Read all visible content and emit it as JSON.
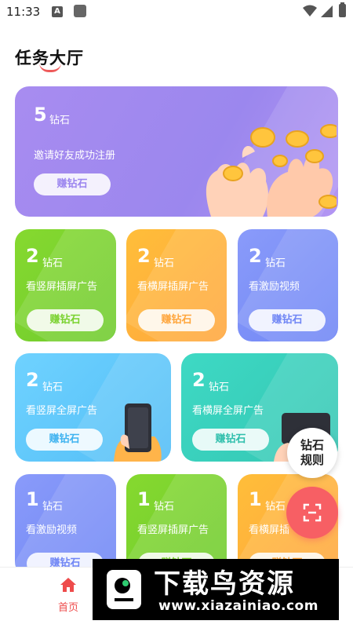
{
  "status_bar": {
    "time": "11:33",
    "a_icon": "A"
  },
  "header": {
    "title": "任务大厅"
  },
  "hero": {
    "amount": "5",
    "unit": "钻石",
    "desc": "邀请好友成功注册",
    "button": "赚钻石"
  },
  "tasks": [
    {
      "amount": "2",
      "unit": "钻石",
      "desc": "看竖屏插屏广告",
      "button": "赚钻石",
      "color": "#7ad22f"
    },
    {
      "amount": "2",
      "unit": "钻石",
      "desc": "看横屏插屏广告",
      "button": "赚钻石",
      "color": "#ffb13b"
    },
    {
      "amount": "2",
      "unit": "钻石",
      "desc": "看激励视频",
      "button": "赚钻石",
      "color": "#7b90f8"
    },
    {
      "amount": "2",
      "unit": "钻石",
      "desc": "看竖屏全屏广告",
      "button": "赚钻石",
      "color": "#5ec7fb"
    },
    {
      "amount": "2",
      "unit": "钻石",
      "desc": "看横屏全屏广告",
      "button": "赚钻石",
      "color": "#39cfbb"
    },
    {
      "amount": "1",
      "unit": "钻石",
      "desc": "看激励视频",
      "button": "赚钻石",
      "color": "#7b90f8"
    },
    {
      "amount": "1",
      "unit": "钻石",
      "desc": "看竖屏插屏广告",
      "button": "赚钻石",
      "color": "#7ad22f"
    },
    {
      "amount": "1",
      "unit": "钻石",
      "desc": "看横屏插",
      "button": "赚钻石",
      "color": "#ffb13b"
    }
  ],
  "fab": {
    "rules_line1": "钻石",
    "rules_line2": "规则"
  },
  "tabbar": {
    "home_label": "首页"
  },
  "watermark": {
    "brand": "下载鸟资源",
    "url": "www.xiazainiao.com"
  }
}
